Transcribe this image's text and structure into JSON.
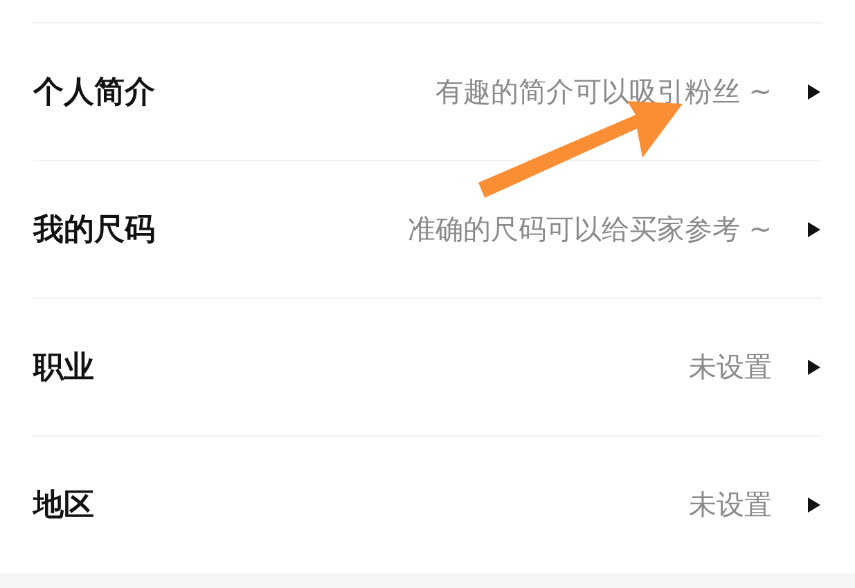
{
  "rows": [
    {
      "label": "个人简介",
      "value": "有趣的简介可以吸引粉丝 ~"
    },
    {
      "label": "我的尺码",
      "value": "准确的尺码可以给买家参考 ~"
    },
    {
      "label": "职业",
      "value": "未设置"
    },
    {
      "label": "地区",
      "value": "未设置"
    }
  ],
  "annotation": {
    "kind": "arrow"
  }
}
